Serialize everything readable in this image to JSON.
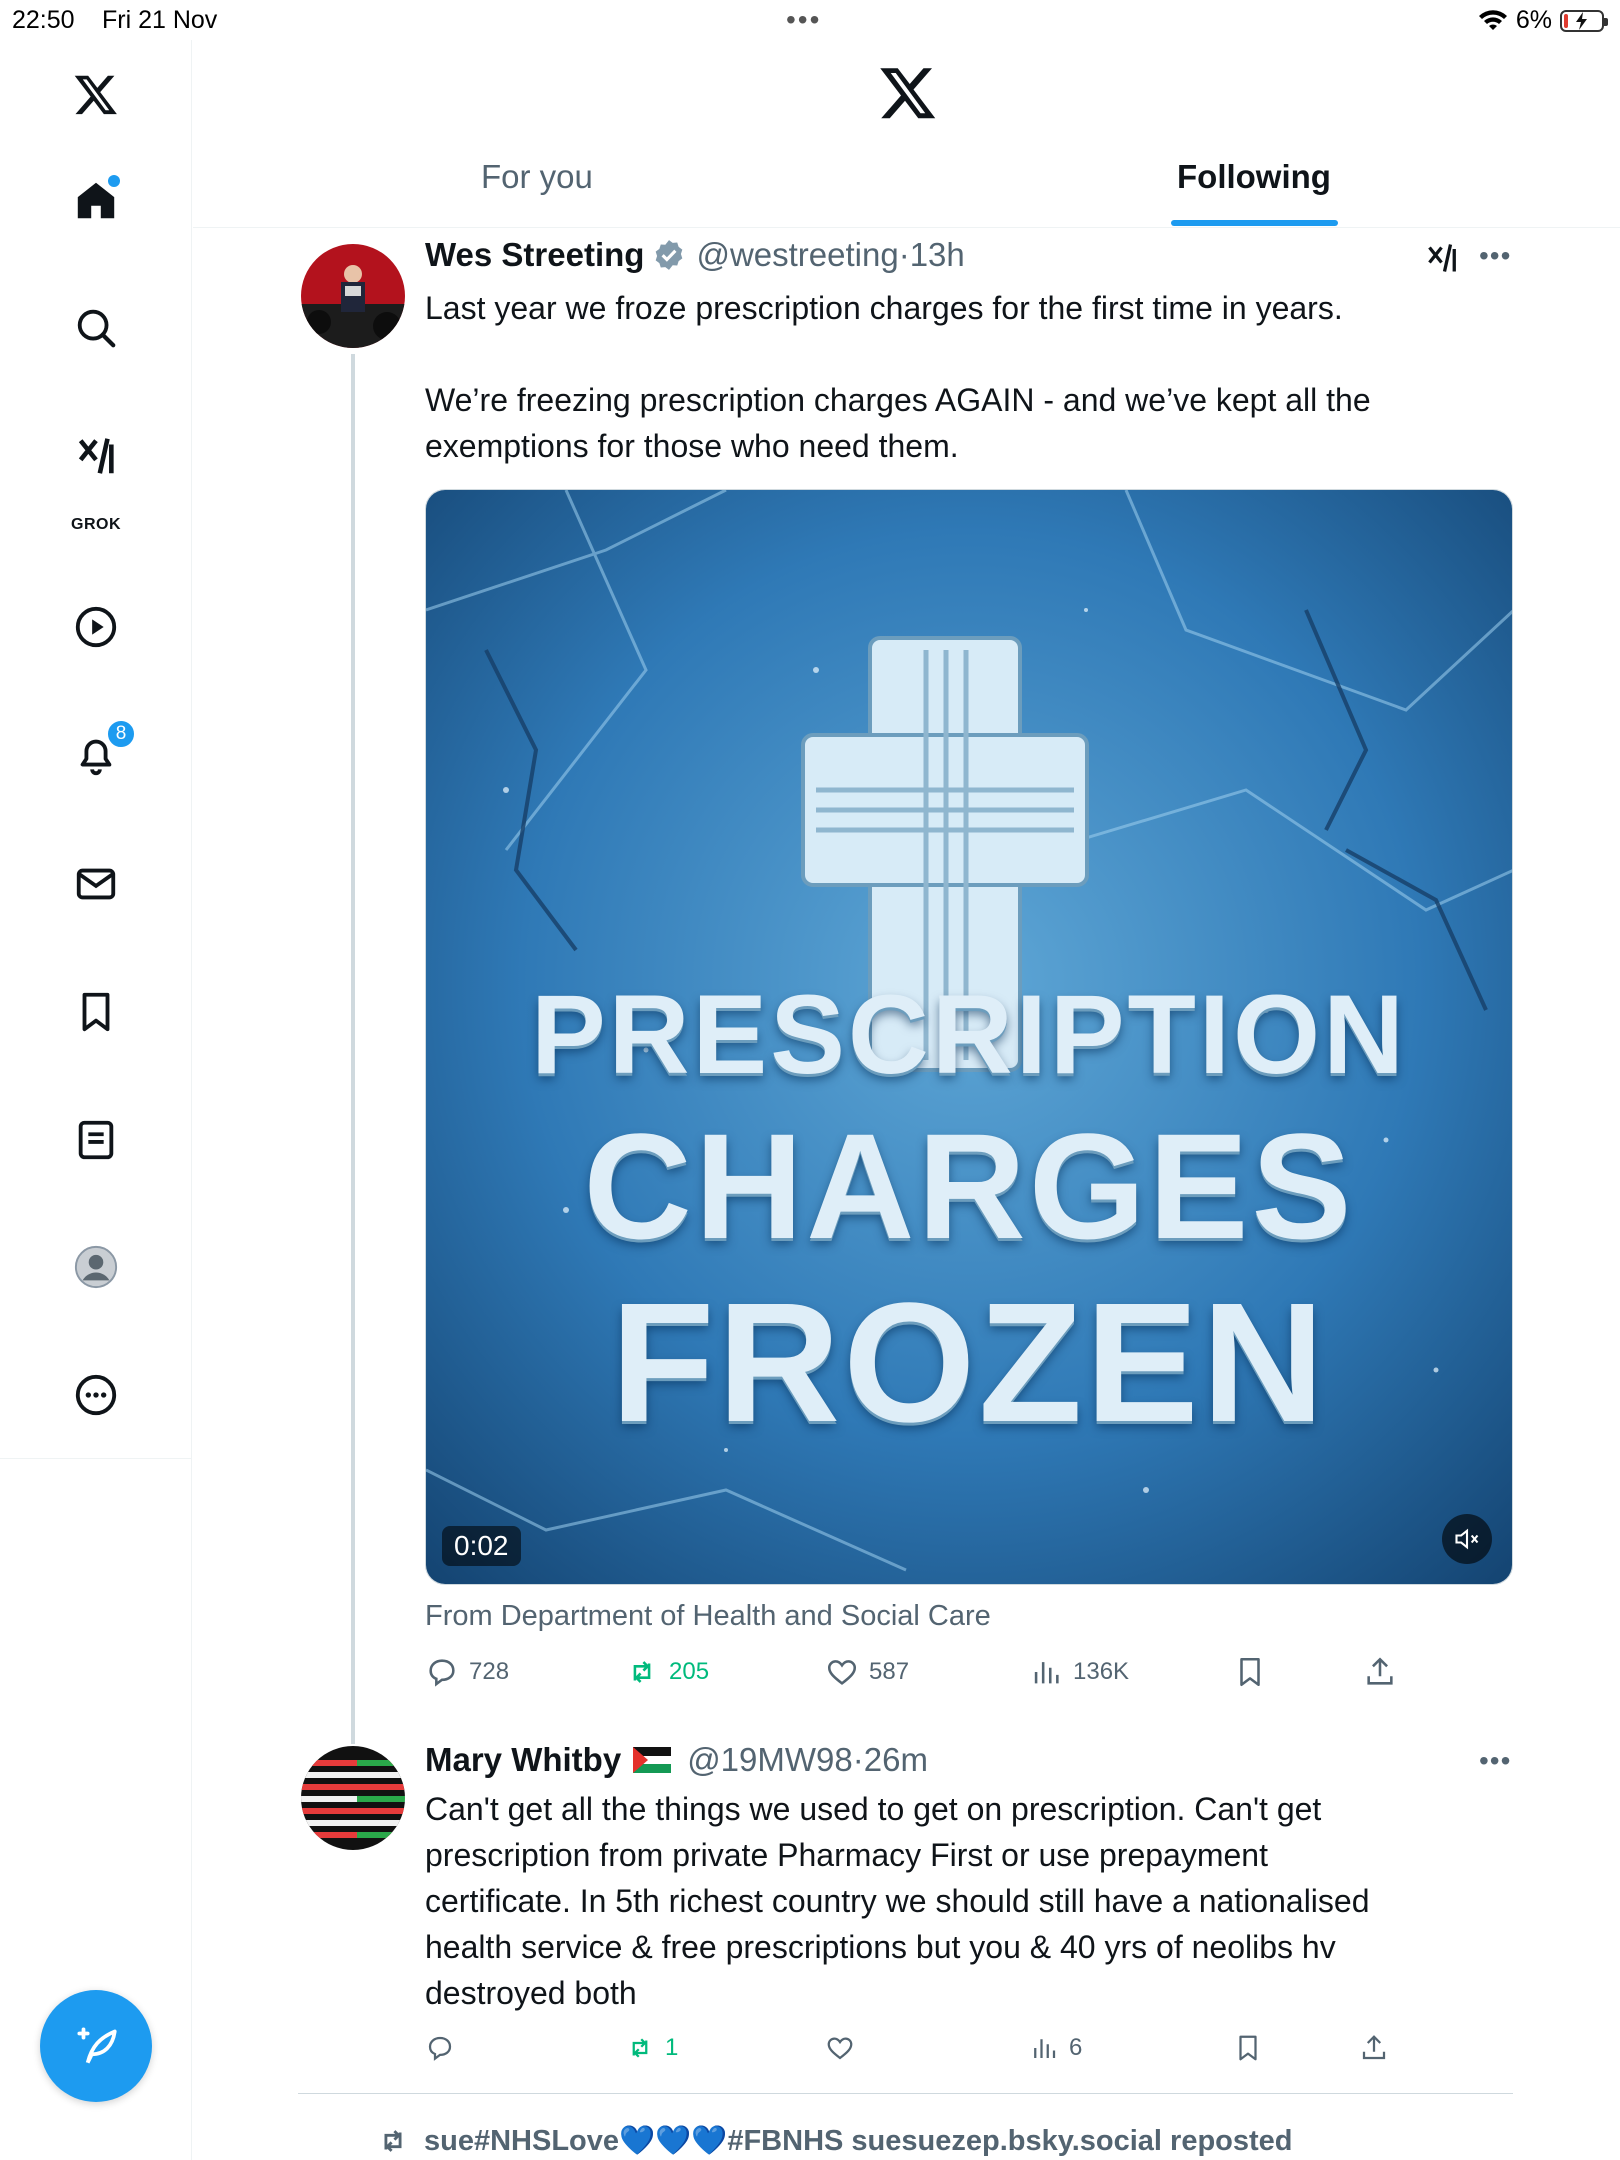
{
  "status_bar": {
    "time": "22:50",
    "date": "Fri 21 Nov",
    "dots": "•••",
    "battery": "6%"
  },
  "sidebar": {
    "notifications_badge": "8",
    "grok_label": "GROK"
  },
  "header": {
    "tabs": [
      {
        "label": "For you",
        "selected": false
      },
      {
        "label": "Following",
        "selected": true
      }
    ]
  },
  "tweets": [
    {
      "name": "Wes Streeting",
      "handle": "@westreeting",
      "time": "·13h",
      "text_lines": [
        "Last year we froze prescription charges for the first time in years.",
        "",
        "We’re freezing prescription charges AGAIN - and we’ve kept all the",
        "exemptions for those who need them."
      ],
      "media": {
        "line1": "PRESCRIPTION",
        "line2": "CHARGES",
        "line3": "FROZEN",
        "duration": "0:02"
      },
      "source": "From Department of Health and Social Care",
      "stats": {
        "replies": "728",
        "reposts": "205",
        "likes": "587",
        "views": "136K"
      }
    },
    {
      "name": "Mary Whitby",
      "handle": "@19MW98",
      "time": "·26m",
      "text_lines": [
        "Can't get all the things we used to get on prescription. Can't get",
        "prescription from private Pharmacy First or use prepayment",
        "certificate. In 5th richest country we should still have a nationalised",
        "health service & free prescriptions but you & 40 yrs of neolibs hv",
        "destroyed both"
      ],
      "stats": {
        "replies": "",
        "reposts": "1",
        "likes": "",
        "views": "6"
      }
    }
  ],
  "repost_notice": "sue#NHSLove💙💙💙#FBNHS suesuezep.bsky.social reposted",
  "colors": {
    "accent": "#1d9bf0",
    "repost_green": "#00ba7c",
    "secondary_text": "#536471"
  }
}
